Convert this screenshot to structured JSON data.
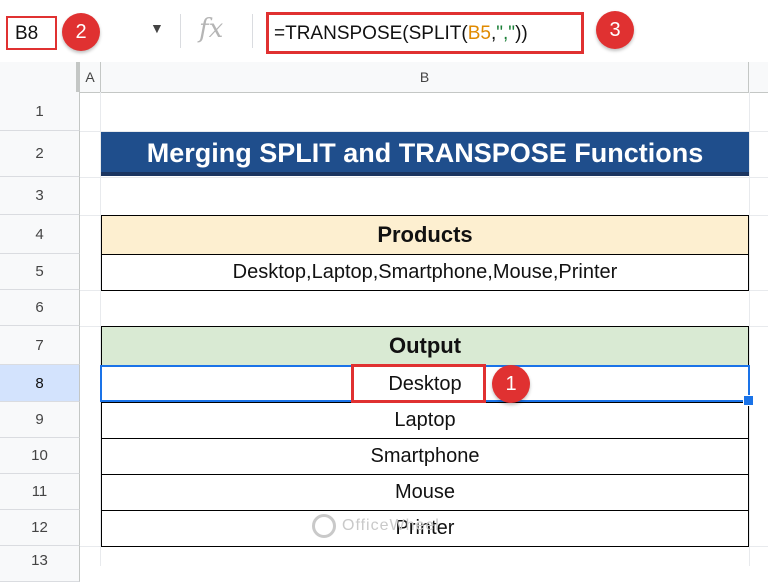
{
  "formula_bar": {
    "name_box": "B8",
    "fx_label": "fx",
    "formula_prefix": "=TRANSPOSE(SPLIT(",
    "formula_ref": "B5",
    "formula_sep": ",",
    "formula_str": "\",\"",
    "formula_suffix": "))"
  },
  "badges": [
    "1",
    "2",
    "3"
  ],
  "columns": [
    "A",
    "B"
  ],
  "rows": [
    "1",
    "2",
    "3",
    "4",
    "5",
    "6",
    "7",
    "8",
    "9",
    "10",
    "11",
    "12",
    "13"
  ],
  "active_row": "8",
  "sheet": {
    "title": "Merging SPLIT and TRANSPOSE Functions",
    "products_header": "Products",
    "products_value": "Desktop,Laptop,Smartphone,Mouse,Printer",
    "output_header": "Output",
    "output_values": [
      "Desktop",
      "Laptop",
      "Smartphone",
      "Mouse",
      "Printer"
    ]
  },
  "watermark": "OfficeWheel",
  "colors": {
    "title_bg": "#1f4e8c",
    "products_header_bg": "#fdefd0",
    "output_header_bg": "#d9ead3",
    "callout_red": "#e03131",
    "selection_blue": "#1a73e8"
  }
}
